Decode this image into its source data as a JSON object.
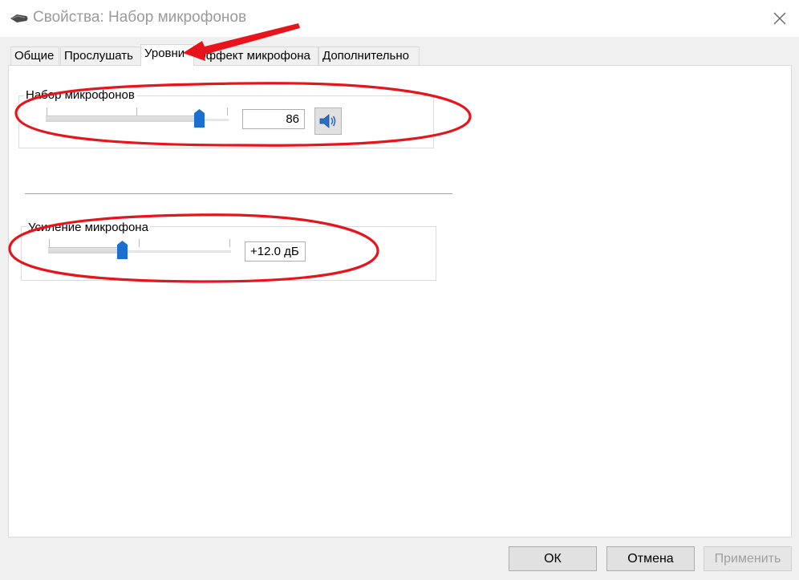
{
  "window": {
    "title": "Свойства: Набор микрофонов"
  },
  "tabs": [
    {
      "label": "Общие",
      "active": false
    },
    {
      "label": "Прослушать",
      "active": false
    },
    {
      "label": "Уровни",
      "active": true
    },
    {
      "label": "Эффект микрофона",
      "active": false
    },
    {
      "label": "Дополнительно",
      "active": false
    }
  ],
  "levels": {
    "microphone": {
      "label": "Набор микрофонов",
      "value": "86",
      "slider_level": 0.86,
      "speaker_icon": "speaker-icon"
    },
    "boost": {
      "label": "Усиление микрофона",
      "value": "+12.0 дБ",
      "slider_level": 0.4
    }
  },
  "buttons": {
    "ok": "ОК",
    "cancel": "Отмена",
    "apply": "Применить"
  },
  "annotation": {
    "color": "#e8141b"
  }
}
